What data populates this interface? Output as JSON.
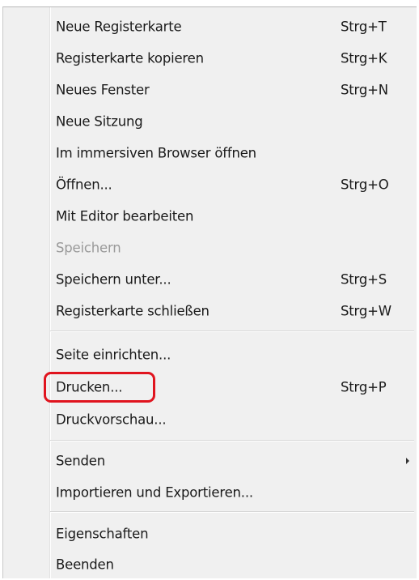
{
  "menu": {
    "items": [
      {
        "label": "Neue Registerkarte",
        "shortcut": "Strg+T"
      },
      {
        "label": "Registerkarte kopieren",
        "shortcut": "Strg+K"
      },
      {
        "label": "Neues Fenster",
        "shortcut": "Strg+N"
      },
      {
        "label": "Neue Sitzung"
      },
      {
        "label": "Im immersiven Browser öffnen"
      },
      {
        "label": "Öffnen...",
        "shortcut": "Strg+O"
      },
      {
        "label": "Mit Editor bearbeiten"
      },
      {
        "label": "Speichern",
        "disabled": true
      },
      {
        "label": "Speichern unter...",
        "shortcut": "Strg+S"
      },
      {
        "label": "Registerkarte schließen",
        "shortcut": "Strg+W"
      },
      {
        "label": "Seite einrichten..."
      },
      {
        "label": "Drucken...",
        "shortcut": "Strg+P",
        "highlighted": true
      },
      {
        "label": "Druckvorschau..."
      },
      {
        "label": "Senden",
        "submenu": true,
        "submenu_icon": "chevron-right-icon"
      },
      {
        "label": "Importieren und Exportieren..."
      },
      {
        "label": "Eigenschaften"
      },
      {
        "label": "Beenden"
      }
    ]
  },
  "colors": {
    "menu_background": "#f0f0f0",
    "text": "#1a1a1a",
    "disabled_text": "#9a9a9a",
    "highlight_ring": "#e0141e"
  }
}
